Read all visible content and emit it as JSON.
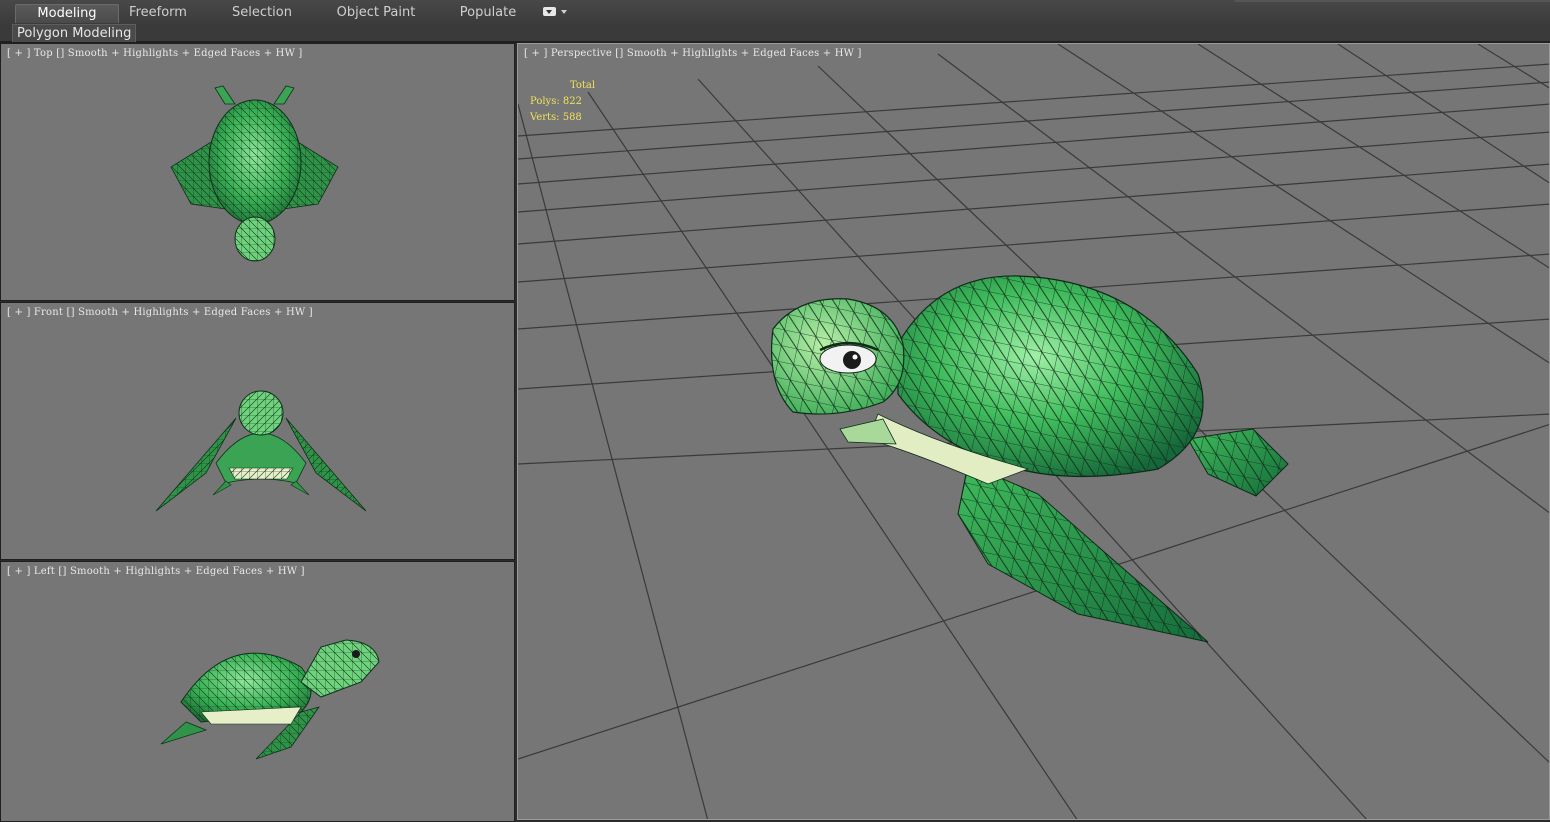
{
  "ribbon": {
    "tabs": [
      {
        "label": "Modeling",
        "active": true
      },
      {
        "label": "Freeform",
        "active": false
      },
      {
        "label": "Selection",
        "active": false
      },
      {
        "label": "Object Paint",
        "active": false
      },
      {
        "label": "Populate",
        "active": false
      }
    ],
    "more_icon": "dropdown-options-icon"
  },
  "subribbon": {
    "panel_label": "Polygon Modeling"
  },
  "viewports": {
    "top": {
      "label": "[ + ] Top [] Smooth + Highlights + Edged Faces + HW ]"
    },
    "front": {
      "label": "[ + ] Front [] Smooth + Highlights + Edged Faces + HW ]"
    },
    "left": {
      "label": "[ + ] Left [] Smooth + Highlights + Edged Faces + HW ]"
    },
    "perspective": {
      "label": "[ + ] Perspective [] Smooth + Highlights + Edged Faces + HW ]",
      "stats": {
        "total_label": "Total",
        "polys": "Polys: 822",
        "verts": "Verts: 588"
      }
    }
  },
  "colors": {
    "viewport_bg": "#767676",
    "grid_line": "#3a3a3a",
    "stats_text": "#f0e25a",
    "turtle_green": "#3fae5a"
  }
}
